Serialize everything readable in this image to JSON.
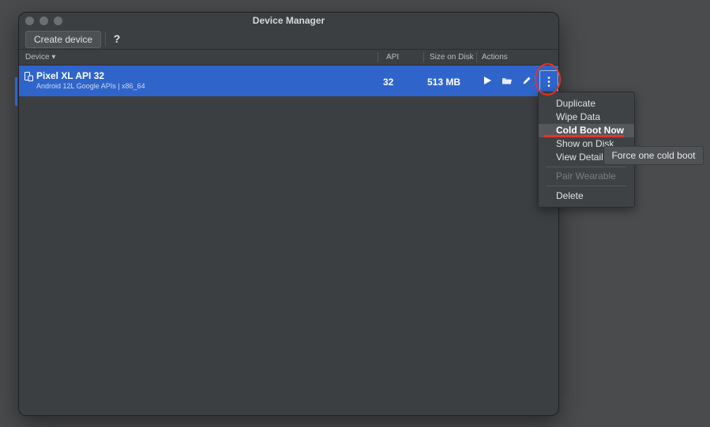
{
  "window": {
    "title": "Device Manager"
  },
  "toolbar": {
    "create_label": "Create device",
    "help_label": "?"
  },
  "table": {
    "headers": {
      "device": "Device ▾",
      "api": "API",
      "size": "Size on Disk",
      "actions": "Actions"
    },
    "rows": [
      {
        "name": "Pixel XL API 32",
        "subtitle": "Android 12L Google APIs | x86_64",
        "api": "32",
        "size": "513 MB"
      }
    ]
  },
  "icons": {
    "device": "phone-tablet-icon",
    "launch": "play-icon",
    "folder": "folder-icon",
    "edit": "pencil-icon",
    "more": "kebab-more-icon"
  },
  "menu": {
    "items": [
      {
        "label": "Duplicate",
        "state": "normal"
      },
      {
        "label": "Wipe Data",
        "state": "normal"
      },
      {
        "label": "Cold Boot Now",
        "state": "selected"
      },
      {
        "label": "Show on Disk",
        "state": "normal"
      },
      {
        "label": "View Details",
        "state": "normal"
      },
      {
        "label": "Pair Wearable",
        "state": "disabled"
      },
      {
        "label": "Delete",
        "state": "normal"
      }
    ]
  },
  "tooltip": {
    "text": "Force one cold boot"
  },
  "colors": {
    "accent": "#2f65ca",
    "annotation": "#e3342b",
    "background": "#3c3f41"
  }
}
